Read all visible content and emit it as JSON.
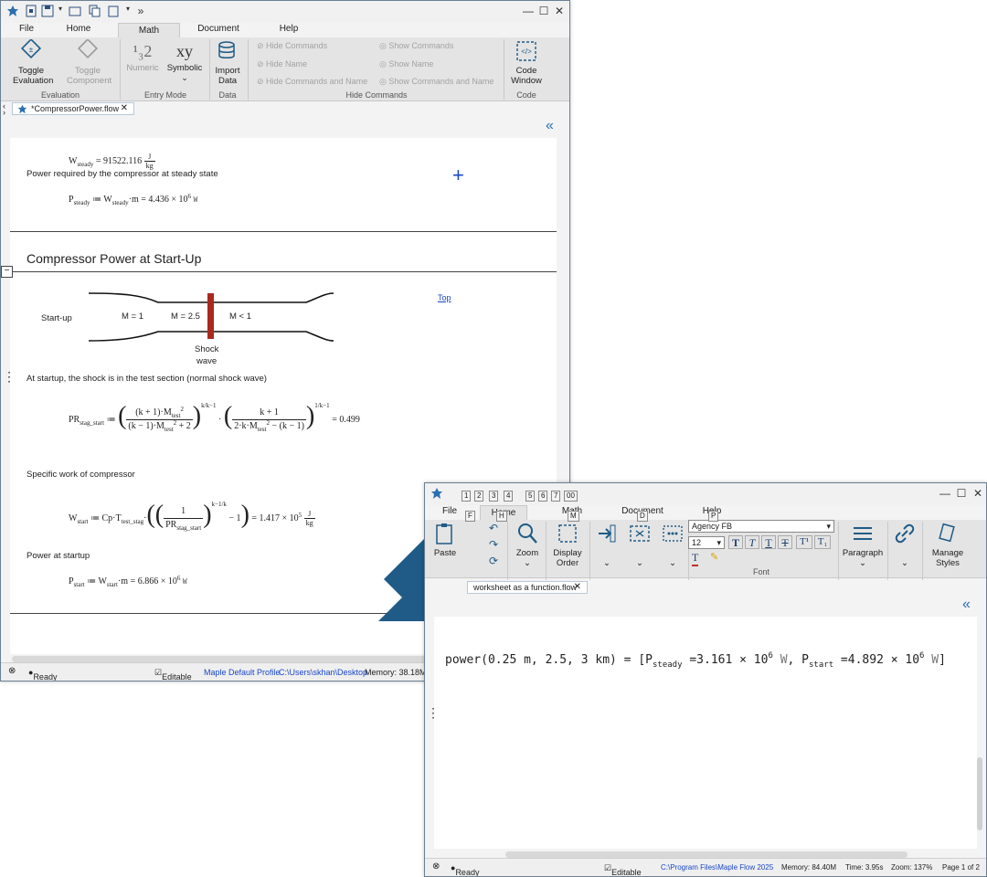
{
  "win1": {
    "menu_tabs": [
      "File",
      "Home",
      "Math",
      "Document",
      "Help"
    ],
    "ribbon": {
      "toggle_evaluation": "Toggle Evaluation",
      "toggle_component": "Toggle Component",
      "numeric": "Numeric",
      "symbolic": "Symbolic",
      "import_data": "Import Data",
      "hide_commands": "Hide Commands",
      "hide_name": "Hide Name",
      "hide_commands_and_name": "Hide Commands and Name",
      "show_commands": "Show Commands",
      "show_name": "Show Name",
      "show_commands_and_name": "Show Commands and Name",
      "code_window": "Code Window",
      "groups": {
        "evaluation": "Evaluation",
        "entry_mode": "Entry Mode",
        "data": "Data",
        "hide_commands": "Hide Commands",
        "code": "Code"
      }
    },
    "doc_tab": "*CompressorPower.flow",
    "content": {
      "w_steady_value": "91522.116",
      "w_steady_unit_num": "J",
      "w_steady_unit_den": "kg",
      "power_required_text": "Power required by the compressor at steady state",
      "p_steady_value": "4.436 × 10",
      "p_steady_exp": "6",
      "p_steady_unit": "W",
      "section_title": "Compressor Power at Start-Up",
      "top_link": "Top",
      "diagram": {
        "startup_label": "Start-up",
        "m1": "M = 1",
        "m25": "M = 2.5",
        "mlt1": "M < 1",
        "shock": "Shock",
        "wave": "wave"
      },
      "startup_text": "At startup, the shock is in the test section  (normal shock wave)",
      "pr_result": "0.499",
      "specific_work_text": "Specific work of compressor",
      "w_start_value": "1.417 × 10",
      "w_start_exp": "5",
      "power_startup_text": "Power at startup",
      "p_start_value": "6.866 × 10",
      "p_start_exp": "6",
      "p_start_unit": "W"
    },
    "status": {
      "ready": "Ready",
      "editable": "Editable",
      "profile": "Maple Default Profile",
      "path": "C:\\Users\\skhan\\Desktop",
      "memory": "Memory: 38.18M"
    }
  },
  "win2": {
    "menu_tabs": [
      "File",
      "Home",
      "Math",
      "Document",
      "Help"
    ],
    "keytips": [
      "1",
      "2",
      "3",
      "4",
      "5",
      "6",
      "7",
      "00",
      "F",
      "H",
      "M",
      "D",
      "P"
    ],
    "ribbon": {
      "paste": "Paste",
      "zoom": "Zoom",
      "display_order": "Display Order",
      "font_name": "Agency FB",
      "font_size": "12",
      "font_group": "Font",
      "paragraph": "Paragraph",
      "manage_styles": "Manage Styles"
    },
    "doc_tab": "worksheet as a function.flow",
    "result": {
      "fn": "power",
      "args": "0.25 m, 2.5, 3 km",
      "p_steady_val": "3.161 × 10",
      "p_steady_exp": "6",
      "p_start_val": "4.892 × 10",
      "p_start_exp": "6",
      "unit": "W"
    },
    "status": {
      "ready": "Ready",
      "editable": "Editable",
      "path": "C:\\Program Files\\Maple Flow 2025",
      "memory": "Memory: 84.40M",
      "time": "Time: 3.95s",
      "zoom": "Zoom: 137%",
      "page": "Page 1 of 2"
    }
  },
  "colors": {
    "accent": "#1f5b86",
    "link": "#1a47c9",
    "shock_bar": "#a82a1f"
  }
}
